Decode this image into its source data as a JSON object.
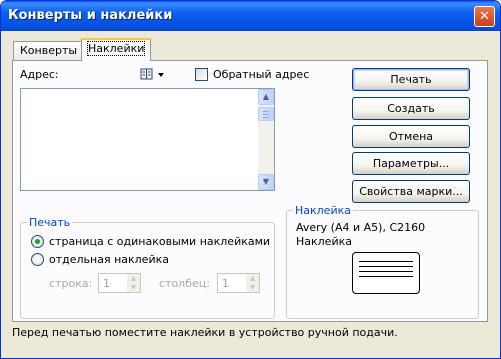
{
  "window": {
    "title": "Конверты и наклейки"
  },
  "tabs": [
    {
      "label": "Конверты",
      "active": false
    },
    {
      "label": "Наклейки",
      "active": true
    }
  ],
  "address": {
    "label": "Адрес:",
    "value": "",
    "address_book_icon": "address-book-icon",
    "return_address_label": "Обратный адрес",
    "return_address_checked": false
  },
  "buttons": {
    "print": "Печать",
    "create": "Создать",
    "cancel": "Отмена",
    "options": "Параметры...",
    "properties": "Свойства марки..."
  },
  "print_group": {
    "title": "Печать",
    "full_page_label": "страница с одинаковыми наклейками",
    "single_label": "отдельная наклейка",
    "selected": "full_page",
    "row_label": "строка:",
    "row_value": "1",
    "column_label": "столбец:",
    "column_value": "1"
  },
  "label_group": {
    "title": "Наклейка",
    "product": "Avery (A4 и A5), C2160",
    "type": "Наклейка"
  },
  "status": "Перед печатью поместите наклейки в устройство ручной подачи.",
  "colors": {
    "title_bar": "#0a5ff0",
    "group_title": "#0046d5",
    "radio_dot": "#21a121"
  }
}
